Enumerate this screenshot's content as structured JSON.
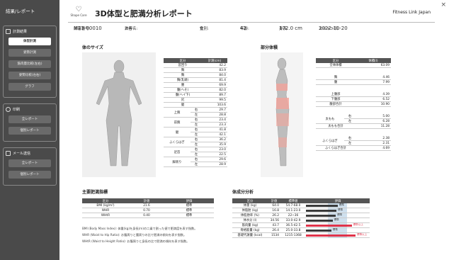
{
  "sidebar": {
    "title": "結果/レポート",
    "section1": {
      "label": "計測結果",
      "buttons": [
        "体型計測",
        "姿勢計測",
        "筋肉量比較(左右)",
        "姿勢比較(左右)",
        "グラフ"
      ]
    },
    "section2": {
      "label": "印刷",
      "buttons": [
        "全レポート",
        "個別レポート"
      ]
    },
    "section3": {
      "label": "メール送信",
      "buttons": [
        "全レポート",
        "個別レポート"
      ]
    }
  },
  "header": {
    "logo_text": "Shape Care",
    "title": "3D体型と肥満分析レポート",
    "brand": "Fitness Link Japan",
    "close": "×"
  },
  "info": {
    "id_label": "顧客番号:",
    "id": "M23-00010",
    "name_label": "お客名:",
    "name": "渋谷",
    "sex_label": "性別:",
    "sex": "女",
    "age_label": "年齢:",
    "age": "42",
    "height_label": "身長:",
    "height": "172.0 cm",
    "date_label": "スキャン日:",
    "date": "2022-10-20"
  },
  "body_size": {
    "heading": "体のサイズ",
    "cols": [
      "区分",
      "計測(cm)"
    ],
    "rows": [
      [
        "首回り",
        "42.2"
      ],
      [
        "胸",
        "83.9"
      ],
      [
        "胸",
        "84.0"
      ],
      [
        "胸(乳頭)",
        "81.4"
      ],
      [
        "腰",
        "69.9"
      ],
      [
        "腹(へそ)",
        "82.0"
      ],
      [
        "腹(ヘイ下)",
        "89.7"
      ],
      [
        "尻",
        "99.5"
      ],
      [
        "腿",
        "103.6"
      ]
    ],
    "paired": [
      {
        "label": "上腕",
        "rows": [
          [
            "右",
            "29.7"
          ],
          [
            "左",
            "28.8"
          ]
        ]
      },
      {
        "label": "前腕",
        "rows": [
          [
            "右",
            "23.4"
          ],
          [
            "左",
            "23.3"
          ]
        ]
      },
      {
        "label": "腿",
        "rows": [
          [
            "右",
            "41.8"
          ],
          [
            "左",
            "42.1"
          ]
        ]
      },
      {
        "label": "ふくらはぎ",
        "rows": [
          [
            "右",
            "36.2"
          ],
          [
            "左",
            "35.9"
          ]
        ]
      },
      {
        "label": "足首",
        "rows": [
          [
            "右",
            "23.0"
          ],
          [
            "左",
            "22.5"
          ]
        ]
      },
      {
        "label": "脚周り",
        "rows": [
          [
            "右",
            "29.6"
          ],
          [
            "左",
            "28.9"
          ]
        ]
      }
    ]
  },
  "partial_volume": {
    "heading": "部分体積",
    "cols": [
      "区分",
      "体積(l)"
    ],
    "total": [
      "全体体積",
      "63.09"
    ],
    "rows1": [
      [
        "胸",
        "4.46"
      ],
      [
        "腹",
        "7.99"
      ]
    ],
    "rows2": [
      [
        "上腹部",
        "4.39"
      ],
      [
        "下腹部",
        "6.52"
      ],
      [
        "腹部合計",
        "10.90"
      ]
    ],
    "thigh": {
      "label": "太もも",
      "rows": [
        [
          "右",
          "5.00"
        ],
        [
          "左",
          "6.28"
        ]
      ],
      "total": [
        "太もも合計",
        "11.28"
      ]
    },
    "calf": {
      "label": "ふくらはぎ",
      "rows": [
        [
          "右",
          "2.38"
        ],
        [
          "左",
          "2.31"
        ]
      ],
      "total": [
        "ふくらはぎ合計",
        "4.69"
      ]
    }
  },
  "obesity": {
    "heading": "主要肥満指標",
    "cols": [
      "区分",
      "計値",
      "評価"
    ],
    "rows": [
      [
        "BMI (kg/m²)",
        "21.6",
        "標準"
      ],
      [
        "WHR",
        "0.70",
        "標準"
      ],
      [
        "WHtR",
        "0.40",
        "標準"
      ]
    ],
    "notes": [
      "BMI (Body Mass Index): 体重(kg)を身長(m)の二乗で割った値で肥満度を表す指数。",
      "WHR (Waist to Hip Ratio): お腹周りと腰周りの比で肥満の傾向を表す指数。",
      "WHtR (Waist to Height Ratio): お腹周りと身長の比で肥満の傾向を表す指数。"
    ]
  },
  "composition": {
    "heading": "体成分分析",
    "cols": [
      "区分",
      "計値",
      "標準値",
      "評価"
    ],
    "rows": [
      [
        "体重 (kg)",
        "64.0",
        "54.7-68.0",
        "標準"
      ],
      [
        "体脂肪 (kg)",
        "16.8",
        "14.1-23.0",
        "標準"
      ],
      [
        "体脂肪率 (%)",
        "26.2",
        "22~36",
        "標準"
      ],
      [
        "体水分 (l)",
        "34.56",
        "33.0-42.9",
        "標準"
      ],
      [
        "筋肉量 (kg)",
        "43.7",
        "36.5-42.5",
        "標準以上"
      ],
      [
        "骨格筋量 (kg)",
        "26.4",
        "25.0-33.8",
        "標準"
      ],
      [
        "基礎代謝量 (kcal)",
        "1534",
        "1215-1368",
        "標準以上"
      ]
    ],
    "levels": [
      0.5,
      0.48,
      0.47,
      0.42,
      0.72,
      0.4,
      0.78
    ]
  },
  "colors": {
    "sidebar": "#4a4a4a",
    "header_cell": "#555555",
    "over": "#e0334a",
    "normal": "#3a3a3a",
    "band": "#cfe0ee",
    "highlight": "#f2a39a"
  }
}
